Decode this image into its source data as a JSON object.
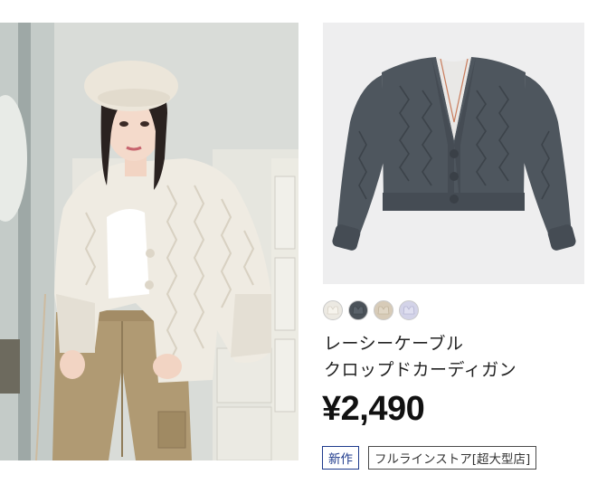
{
  "product": {
    "name_line1": "レーシーケーブル",
    "name_line2": "クロップドカーディガン",
    "price": "¥2,490",
    "badges": {
      "new": "新作",
      "store": "フルラインストア[超大型店]"
    },
    "swatches": [
      {
        "name": "off-white",
        "color": "#ece9e2"
      },
      {
        "name": "dark-gray",
        "color": "#4b5259"
      },
      {
        "name": "beige",
        "color": "#d7cbb8"
      },
      {
        "name": "lavender",
        "color": "#d3d3e8"
      }
    ],
    "product_color": "#4e565e"
  }
}
